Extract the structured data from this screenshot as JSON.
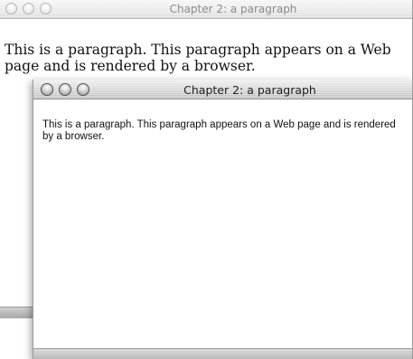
{
  "windows": [
    {
      "title": "Chapter 2: a paragraph",
      "paragraph": "This is a paragraph. This paragraph appears on a Web page and is rendered by a browser."
    },
    {
      "title": "Chapter 2: a paragraph",
      "paragraph": "This is a paragraph. This paragraph appears on a Web page and is rendered by a browser."
    }
  ],
  "colors": {
    "window_background": "#ffffff",
    "titlebar_active": "#d4d4d4",
    "titlebar_inactive": "#e6e6e6"
  },
  "icons": {
    "traffic_lights": [
      "close-button-icon",
      "minimize-button-icon",
      "zoom-button-icon"
    ]
  }
}
